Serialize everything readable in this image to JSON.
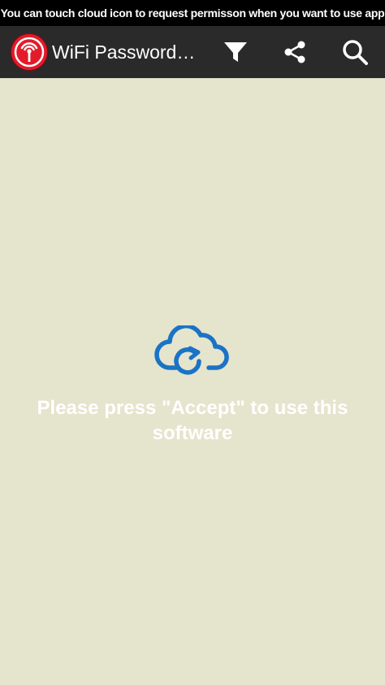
{
  "banner": {
    "text": "You can touch cloud icon to request permisson  when you want to use app"
  },
  "appbar": {
    "title": "WiFi Password…",
    "logo_icon": "wifi-tower-icon",
    "actions": [
      {
        "name": "filter",
        "icon": "filter-funnel-icon"
      },
      {
        "name": "share",
        "icon": "share-icon"
      },
      {
        "name": "search",
        "icon": "search-icon"
      }
    ]
  },
  "main": {
    "cloud_icon": "cloud-sync-icon",
    "message": "Please press \"Accept\" to use this software"
  },
  "colors": {
    "background": "#e5e4cd",
    "banner": "#000000",
    "appbar": "#2a2a2a",
    "logo": "#e21b2a",
    "cloud": "#1a73c7",
    "text": "#ffffff"
  }
}
